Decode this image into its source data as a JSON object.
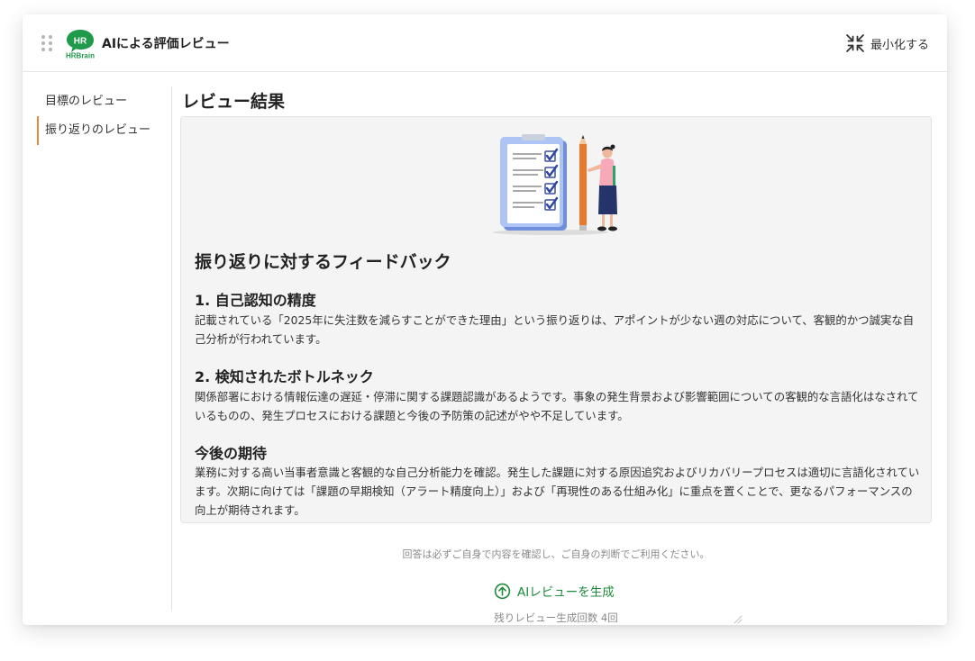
{
  "header": {
    "brand_badge": "HR",
    "brand_name": "HRBrain",
    "title": "AIによる評価レビュー",
    "minimize_label": "最小化する"
  },
  "sidebar": {
    "items": [
      {
        "label": "目標のレビュー",
        "active": false
      },
      {
        "label": "振り返りのレビュー",
        "active": true
      }
    ]
  },
  "main": {
    "title": "レビュー結果",
    "feedback_title": "振り返りに対するフィードバック",
    "sections": [
      {
        "heading": "1. 自己認知の精度",
        "body": "記載されている「2025年に失注数を減らすことができた理由」という振り返りは、アポイントが少ない週の対応について、客観的かつ誠実な自己分析が行われています。"
      },
      {
        "heading": "2. 検知されたボトルネック",
        "body": "関係部署における情報伝達の遅延・停滞に関する課題認識があるようです。事象の発生背景および影響範囲についての客観的な言語化はなされているものの、発生プロセスにおける課題と今後の予防策の記述がやや不足しています。"
      },
      {
        "heading": "今後の期待",
        "body": "業務に対する高い当事者意識と客観的な自己分析能力を確認。発生した課題に対する原因追究およびリカバリープロセスは適切に言語化されています。次期に向けては「課題の早期検知（アラート精度向上）」および「再現性のある仕組み化」に重点を置くことで、更なるパフォーマンスの向上が期待されます。"
      }
    ],
    "disclaimer": "回答は必ずご自身で内容を確認し、ご自身の判断でご利用ください。",
    "generate_label": "AIレビューを生成",
    "remaining": "残りレビュー生成回数 4回"
  },
  "colors": {
    "brand_green": "#1e9a4a",
    "accent_orange": "#e8893a",
    "panel_bg": "#f4f4f4",
    "link_green": "#1e8a3c"
  },
  "icons": {
    "drag": "drag-handle-icon",
    "minimize": "minimize-arrows-icon",
    "generate": "arrow-up-circle-icon"
  }
}
